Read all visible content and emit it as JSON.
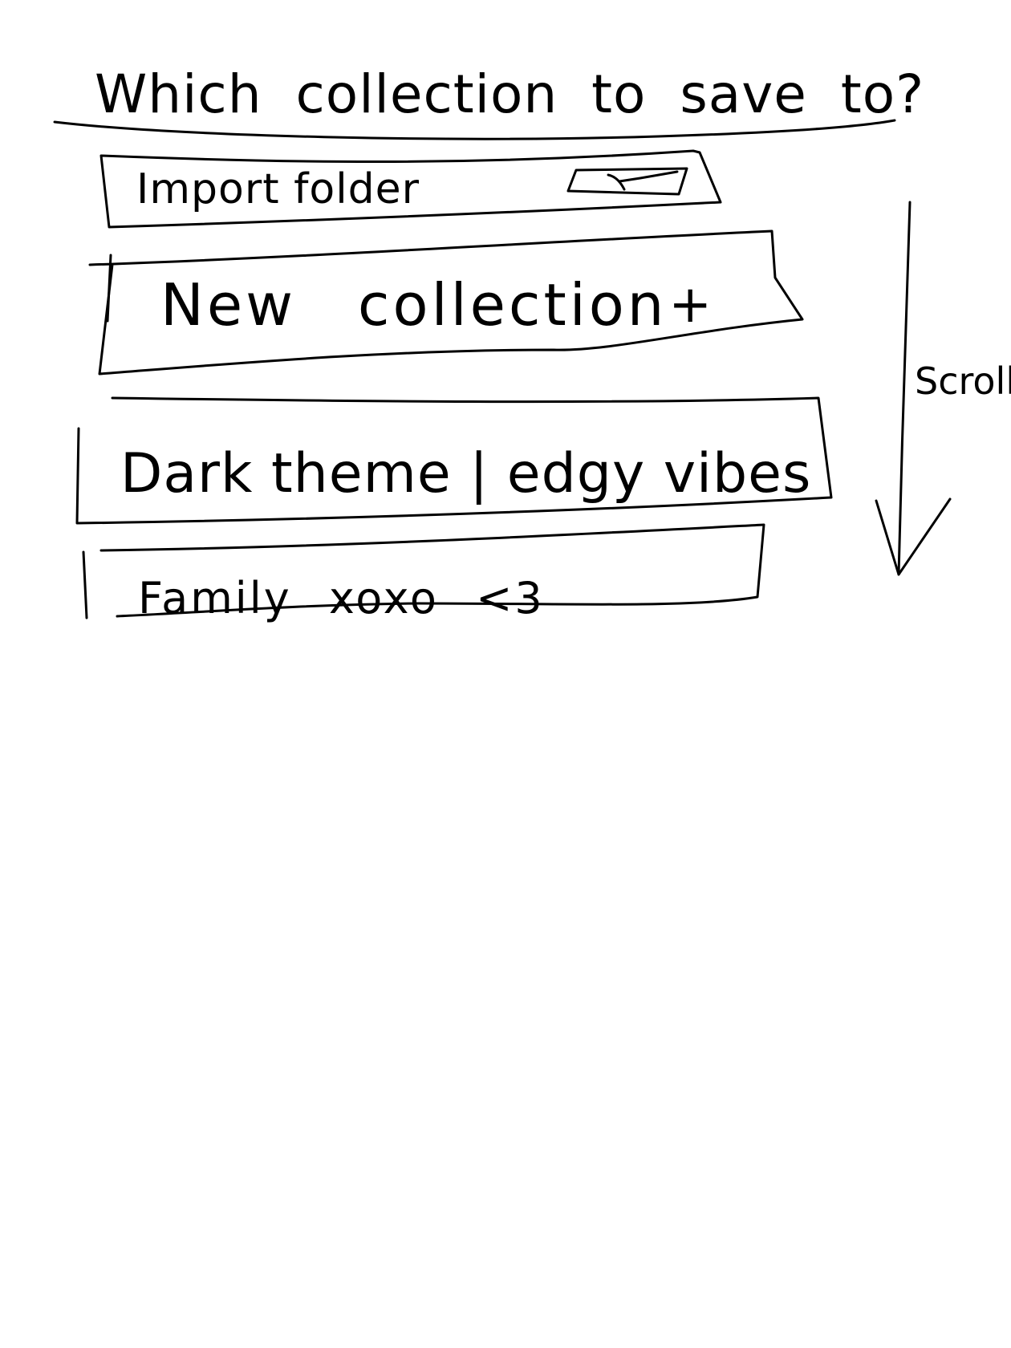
{
  "title": "Which collection to save to?",
  "collections": [
    {
      "label": "Import folder"
    },
    {
      "label": "New collection",
      "action_icon": "plus-icon",
      "action_symbol": "+"
    },
    {
      "label": "Dark theme | edgy vibes"
    },
    {
      "label": "Family xoxo <3"
    }
  ],
  "import_toggle": {
    "icon": "toggle-switch-icon"
  },
  "scroll_hint": {
    "label": "Scroll",
    "icon": "arrow-down-icon"
  },
  "colors": {
    "ink": "#000000",
    "background": "#ffffff"
  }
}
